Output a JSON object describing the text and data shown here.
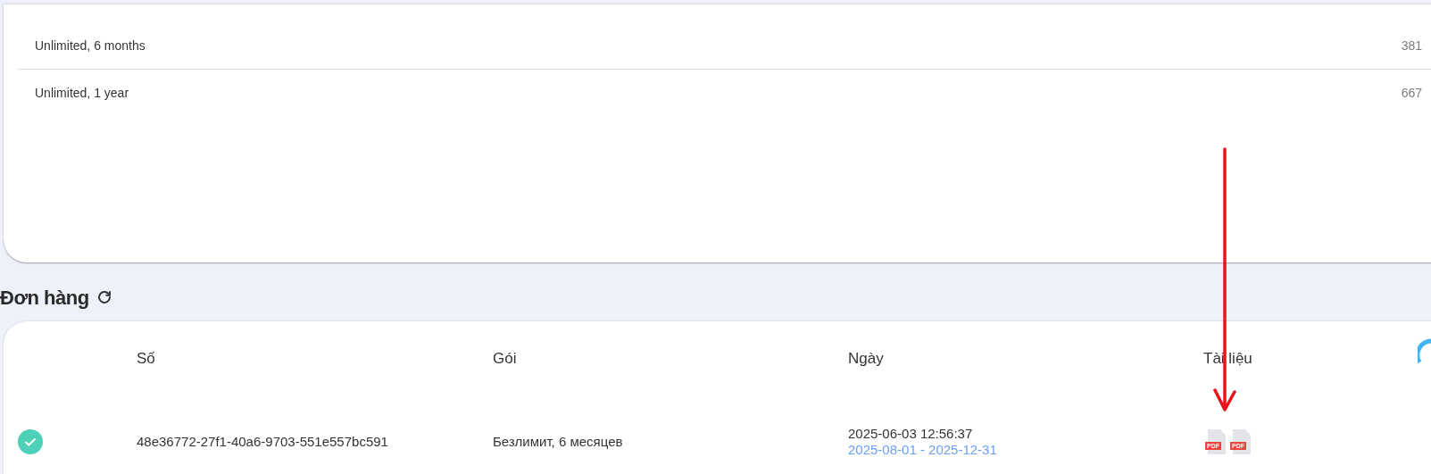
{
  "plans": {
    "rows": [
      {
        "name": "Unlimited, 6 months",
        "value": "381"
      },
      {
        "name": "Unlimited, 1 year",
        "value": "667"
      }
    ]
  },
  "orders": {
    "title": "Đơn hàng",
    "columns": [
      "Số",
      "Gói",
      "Ngày",
      "Tài liệu"
    ],
    "rows": [
      {
        "done": true,
        "number": "48e36772-27f1-40a6-9703-551e557bc591",
        "package": "Безлимит, 6 месяцев",
        "created": "2025-06-03 12:56:37",
        "period": "2025-08-01 - 2025-12-31",
        "documents": [
          {
            "label": "PDF"
          },
          {
            "label": "PDF"
          }
        ]
      }
    ]
  }
}
